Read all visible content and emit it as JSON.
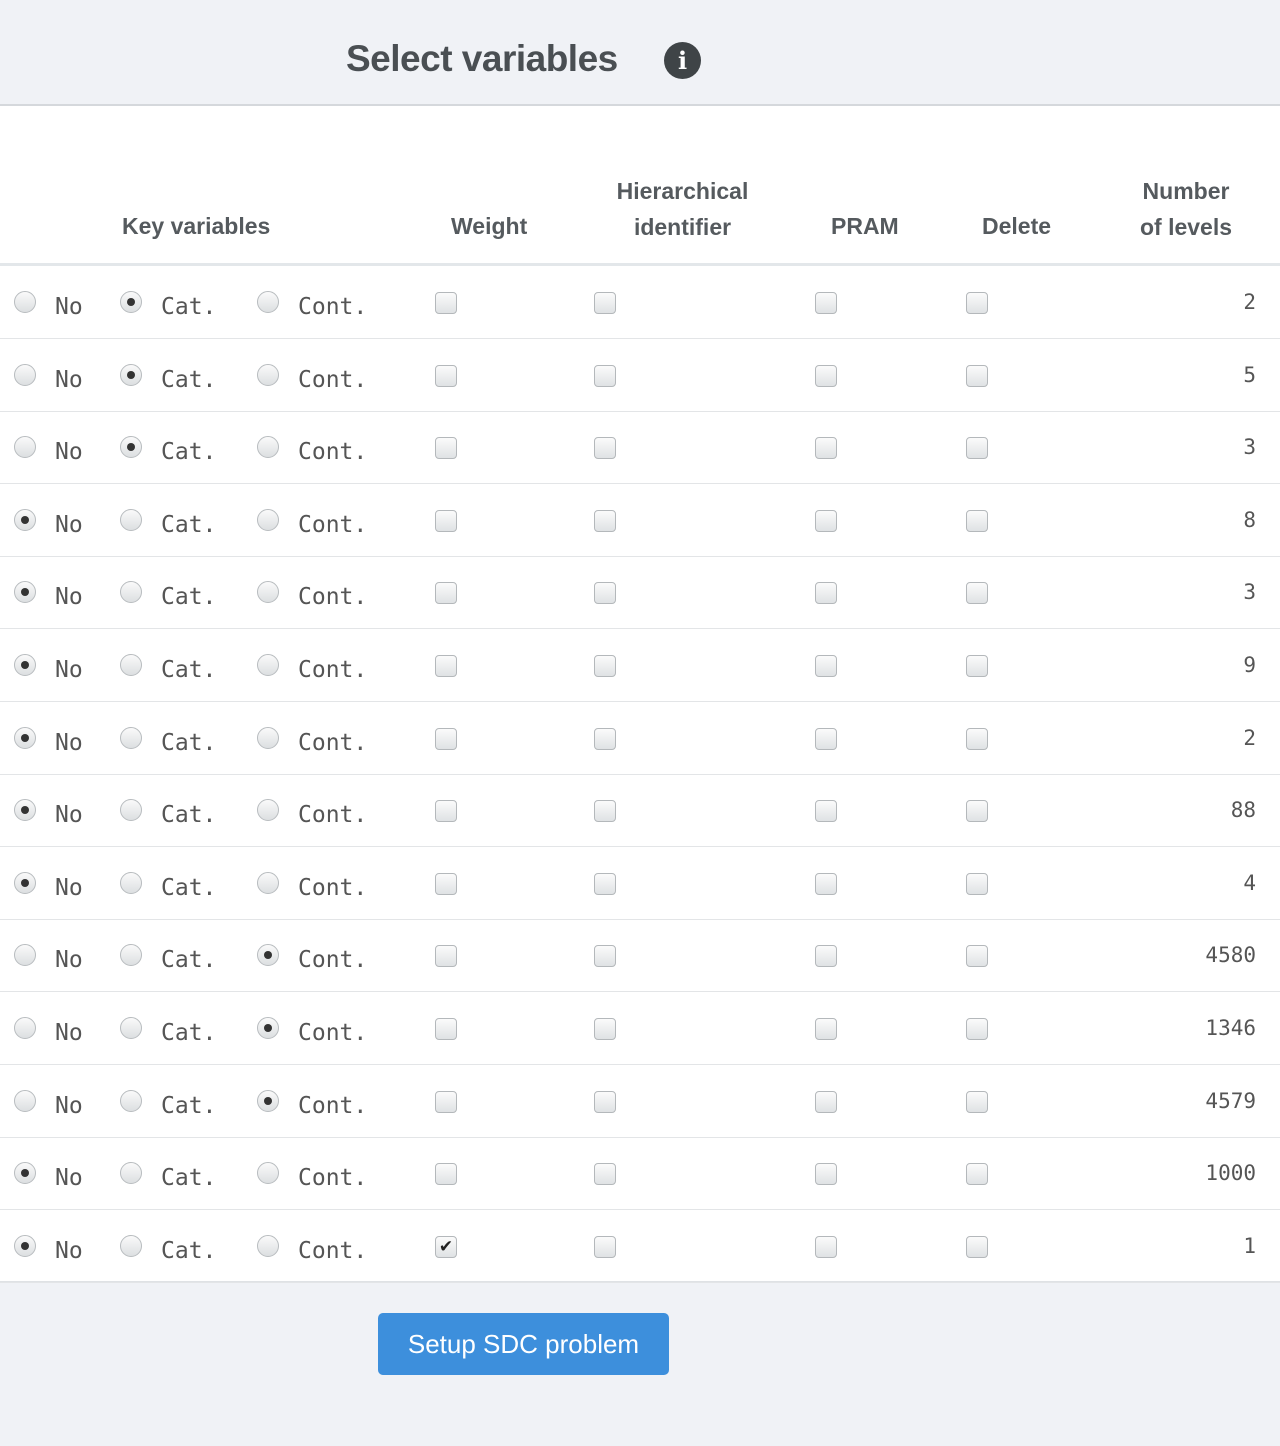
{
  "title": "Select variables",
  "info_icon": "info-circle-icon",
  "headers": {
    "key_variables": "Key variables",
    "weight": "Weight",
    "hier_line1": "Hierarchical",
    "hier_line2": "identifier",
    "pram": "PRAM",
    "delete": "Delete",
    "levels_line1": "Number",
    "levels_line2": "of levels"
  },
  "option_labels": {
    "no": "No",
    "cat": "Cat.",
    "cont": "Cont."
  },
  "rows": [
    {
      "key": "cat",
      "weight": false,
      "hier": false,
      "pram": false,
      "delete": false,
      "levels": "2"
    },
    {
      "key": "cat",
      "weight": false,
      "hier": false,
      "pram": false,
      "delete": false,
      "levels": "5"
    },
    {
      "key": "cat",
      "weight": false,
      "hier": false,
      "pram": false,
      "delete": false,
      "levels": "3"
    },
    {
      "key": "no",
      "weight": false,
      "hier": false,
      "pram": false,
      "delete": false,
      "levels": "8"
    },
    {
      "key": "no",
      "weight": false,
      "hier": false,
      "pram": false,
      "delete": false,
      "levels": "3"
    },
    {
      "key": "no",
      "weight": false,
      "hier": false,
      "pram": false,
      "delete": false,
      "levels": "9"
    },
    {
      "key": "no",
      "weight": false,
      "hier": false,
      "pram": false,
      "delete": false,
      "levels": "2"
    },
    {
      "key": "no",
      "weight": false,
      "hier": false,
      "pram": false,
      "delete": false,
      "levels": "88"
    },
    {
      "key": "no",
      "weight": false,
      "hier": false,
      "pram": false,
      "delete": false,
      "levels": "4"
    },
    {
      "key": "cont",
      "weight": false,
      "hier": false,
      "pram": false,
      "delete": false,
      "levels": "4580"
    },
    {
      "key": "cont",
      "weight": false,
      "hier": false,
      "pram": false,
      "delete": false,
      "levels": "1346"
    },
    {
      "key": "cont",
      "weight": false,
      "hier": false,
      "pram": false,
      "delete": false,
      "levels": "4579"
    },
    {
      "key": "no",
      "weight": false,
      "hier": false,
      "pram": false,
      "delete": false,
      "levels": "1000"
    },
    {
      "key": "no",
      "weight": true,
      "hier": false,
      "pram": false,
      "delete": false,
      "levels": "1"
    }
  ],
  "setup_button": "Setup SDC problem",
  "colors": {
    "button": "#3d8fdc",
    "background": "#f0f2f6"
  }
}
